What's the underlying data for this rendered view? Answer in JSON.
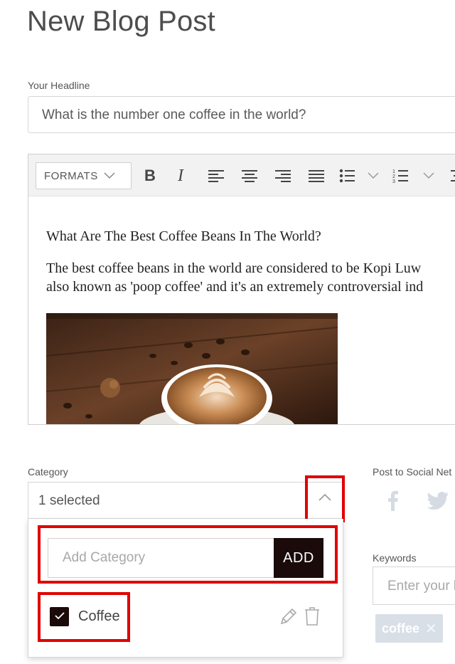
{
  "page": {
    "title": "New Blog Post"
  },
  "headline": {
    "label": "Your Headline",
    "value": "What is the number one coffee in the world?"
  },
  "editor": {
    "toolbar": {
      "formats_label": "FORMATS",
      "icons": [
        "bold-icon",
        "italic-icon",
        "align-left-icon",
        "align-center-icon",
        "align-right-icon",
        "align-justify-icon",
        "bullet-list-icon",
        "numbered-list-icon"
      ]
    },
    "content": {
      "heading": "What Are The Best Coffee Beans In The World?",
      "paragraph_line1": "The best coffee beans in the world are considered to be Kopi Luw",
      "paragraph_line2": "also known as 'poop coffee' and it's an extremely controversial ind"
    }
  },
  "category": {
    "label": "Category",
    "selected_text": "1 selected",
    "add_placeholder": "Add Category",
    "add_button": "ADD",
    "items": [
      {
        "label": "Coffee",
        "checked": true
      }
    ]
  },
  "social": {
    "label": "Post to Social Net",
    "icons": [
      "facebook-icon",
      "twitter-icon"
    ]
  },
  "keywords": {
    "label": "Keywords",
    "placeholder": "Enter your k",
    "tags": [
      "coffee"
    ]
  },
  "colors": {
    "highlight": "#e00000",
    "dark_button": "#1a0a0a",
    "tag_background": "#d9dfe7"
  }
}
